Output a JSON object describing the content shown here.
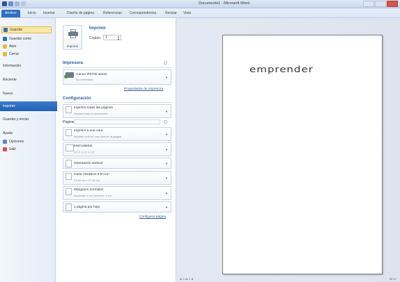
{
  "window": {
    "title": "Documento1 - Microsoft Word"
  },
  "ribbon": {
    "tabs": [
      "Archivo",
      "Inicio",
      "Insertar",
      "Diseño de página",
      "Referencias",
      "Correspondencia",
      "Revisar",
      "Vista"
    ]
  },
  "nav": {
    "items": [
      {
        "label": "Guardar",
        "icon": "save-icon",
        "color": "#2f6fc1"
      },
      {
        "label": "Guardar como",
        "icon": "save-as-icon",
        "color": "#2f6fc1"
      },
      {
        "label": "Abrir",
        "icon": "folder-icon",
        "color": "#e6b93a"
      },
      {
        "label": "Cerrar",
        "icon": "folder-close-icon",
        "color": "#e6b93a"
      },
      {
        "label": "Información"
      },
      {
        "label": "Reciente"
      },
      {
        "label": "Nuevo"
      },
      {
        "label": "Imprimir"
      },
      {
        "label": "Guardar y enviar"
      },
      {
        "label": "Ayuda"
      },
      {
        "label": "Opciones",
        "icon": "options-icon",
        "color": "#5a8ad0"
      },
      {
        "label": "Salir",
        "icon": "exit-icon",
        "color": "#d9534f"
      }
    ]
  },
  "print": {
    "heading": "Imprimir",
    "button_label": "Imprimir",
    "copies_label": "Copias:",
    "copies_value": "1"
  },
  "printer": {
    "section": "Impresora",
    "name": "Canon iP2700 series",
    "status": "No conectado",
    "properties_link": "Propiedades de impresora"
  },
  "settings": {
    "section": "Configuración",
    "pages_label": "Páginas:",
    "options": [
      {
        "main": "Imprimir todas las páginas",
        "sub": "Imprimir todo el documento"
      },
      {
        "main": "Imprimir a una cara",
        "sub": "Imprimir solo en una cara de la página"
      },
      {
        "main": "Intercaladas",
        "sub": "1,2,3   1,2,3   1,2,3"
      },
      {
        "main": "Orientación vertical",
        "sub": ""
      },
      {
        "main": "Carta 22x28cm 8.5\"x11\"",
        "sub": "21.59 cm x 27.94 cm"
      },
      {
        "main": "Márgenes normales",
        "sub": "Izquierda: 3 cm    Derecha: 3 cm"
      },
      {
        "main": "1 página por hoja",
        "sub": ""
      }
    ],
    "page_setup_link": "Configurar página"
  },
  "preview": {
    "document_text": "emprender",
    "page_nav": "◄  1  de 1  ►",
    "zoom": "55 %"
  }
}
